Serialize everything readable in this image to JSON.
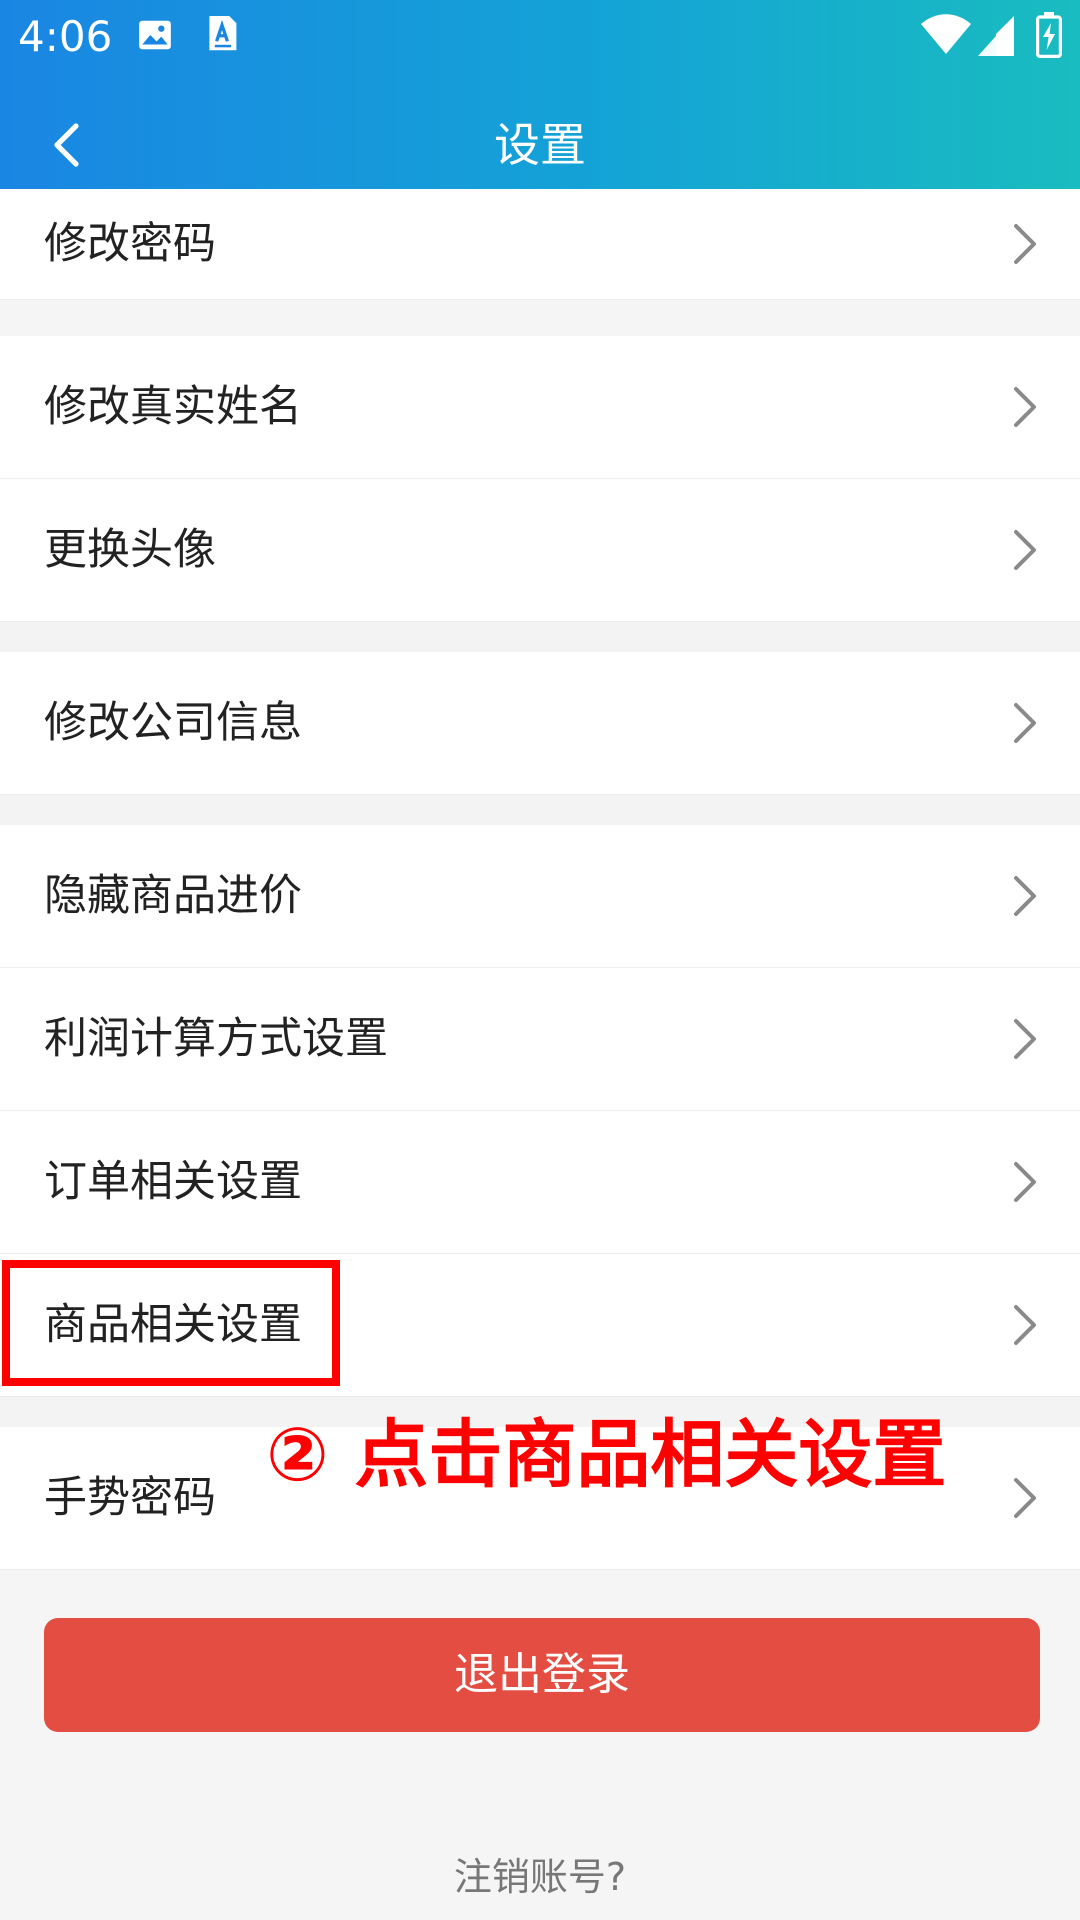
{
  "status_bar": {
    "time": "4:06"
  },
  "app_bar": {
    "title": "设置"
  },
  "list_items": [
    {
      "label": "修改密码"
    },
    {
      "label": "修改真实姓名"
    },
    {
      "label": "更换头像"
    },
    {
      "label": "修改公司信息"
    },
    {
      "label": "隐藏商品进价"
    },
    {
      "label": "利润计算方式设置"
    },
    {
      "label": "订单相关设置"
    },
    {
      "label": "商品相关设置"
    },
    {
      "label": "手势密码"
    }
  ],
  "annotation": {
    "text": "② 点击商品相关设置"
  },
  "logout": {
    "label": "退出登录"
  },
  "cancel_account": {
    "label": "注销账号?"
  },
  "colors": {
    "header_start": "#1a86e3",
    "header_end": "#19bcc0",
    "logout_bg": "#e44d42",
    "annotation": "#ff0000"
  },
  "icons": {
    "back": "chevron-left-icon",
    "row": "chevron-right-icon",
    "gallery": "image-icon",
    "app_a": "text-app-icon",
    "wifi": "wifi-icon",
    "signal": "signal-icon",
    "battery": "battery-charging-icon"
  }
}
